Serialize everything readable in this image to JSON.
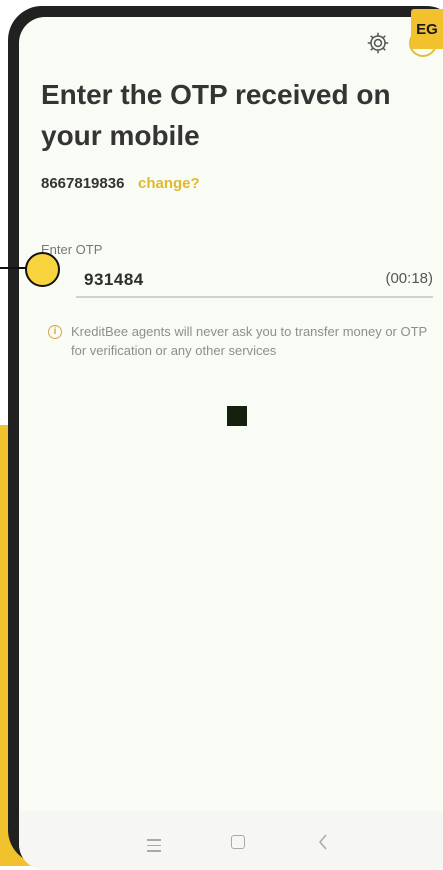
{
  "header": {
    "language_badge": "EG",
    "icons": [
      "gear-icon",
      "help-icon"
    ]
  },
  "title": "Enter the OTP received on your mobile",
  "phone": {
    "number": "8667819836",
    "change_link": "change?"
  },
  "otp": {
    "label": "Enter OTP",
    "value": "931484",
    "timer": "(00:18)"
  },
  "info": {
    "icon": "info-icon",
    "text": "KreditBee agents will never ask you to transfer money or OTP for verification or any other services"
  },
  "nav": {
    "icons": [
      "recents-icon",
      "home-icon",
      "back-icon"
    ]
  },
  "colors": {
    "accent": "#f1c12e",
    "link": "#e0b92e",
    "screen_bg": "#f8fcf5",
    "text_dark": "#343434"
  }
}
